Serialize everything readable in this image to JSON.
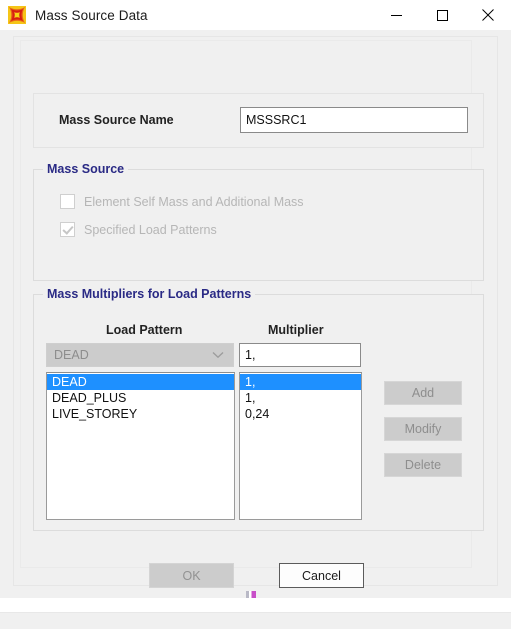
{
  "window": {
    "title": "Mass Source Data",
    "icon": "etabs-star-icon",
    "caption_buttons": [
      {
        "name": "minimize-button",
        "glyph": "minimize-icon"
      },
      {
        "name": "maximize-button",
        "glyph": "maximize-icon"
      },
      {
        "name": "close-button",
        "glyph": "close-icon"
      }
    ]
  },
  "name_panel": {
    "label": "Mass Source Name",
    "value": "MSSSRC1",
    "placeholder": ""
  },
  "mass_source_group": {
    "title": "Mass Source",
    "checkboxes": [
      {
        "label": "Element Self Mass and Additional Mass",
        "checked": false,
        "enabled": false
      },
      {
        "label": "Specified Load Patterns",
        "checked": true,
        "enabled": false
      }
    ]
  },
  "mass_multipliers_group": {
    "title": "Mass Multipliers for Load Patterns",
    "headers": {
      "load_pattern": "Load Pattern",
      "multiplier": "Multiplier"
    },
    "load_pattern_combo": {
      "selected": "DEAD",
      "enabled": false,
      "options": [
        "DEAD",
        "DEAD_PLUS",
        "LIVE_STOREY"
      ]
    },
    "multiplier_input": {
      "value": "1,",
      "placeholder": ""
    },
    "rows": [
      {
        "load_pattern": "DEAD",
        "multiplier": "1,",
        "selected": true
      },
      {
        "load_pattern": "DEAD_PLUS",
        "multiplier": "1,",
        "selected": false
      },
      {
        "load_pattern": "LIVE_STOREY",
        "multiplier": "0,24",
        "selected": false
      }
    ],
    "buttons": [
      {
        "name": "add-button",
        "label": "Add",
        "enabled": false
      },
      {
        "name": "modify-button",
        "label": "Modify",
        "enabled": false
      },
      {
        "name": "delete-button",
        "label": "Delete",
        "enabled": false
      }
    ]
  },
  "dialog_buttons": {
    "ok": {
      "label": "OK",
      "enabled": false
    },
    "cancel": {
      "label": "Cancel",
      "enabled": true
    }
  },
  "colors": {
    "dialog_bg": "#f0f0f0",
    "group_title": "#2a2a85",
    "selection": "#1e90ff",
    "disabled_text": "#b6b6b6",
    "button_disabled_bg": "#cccccc"
  }
}
